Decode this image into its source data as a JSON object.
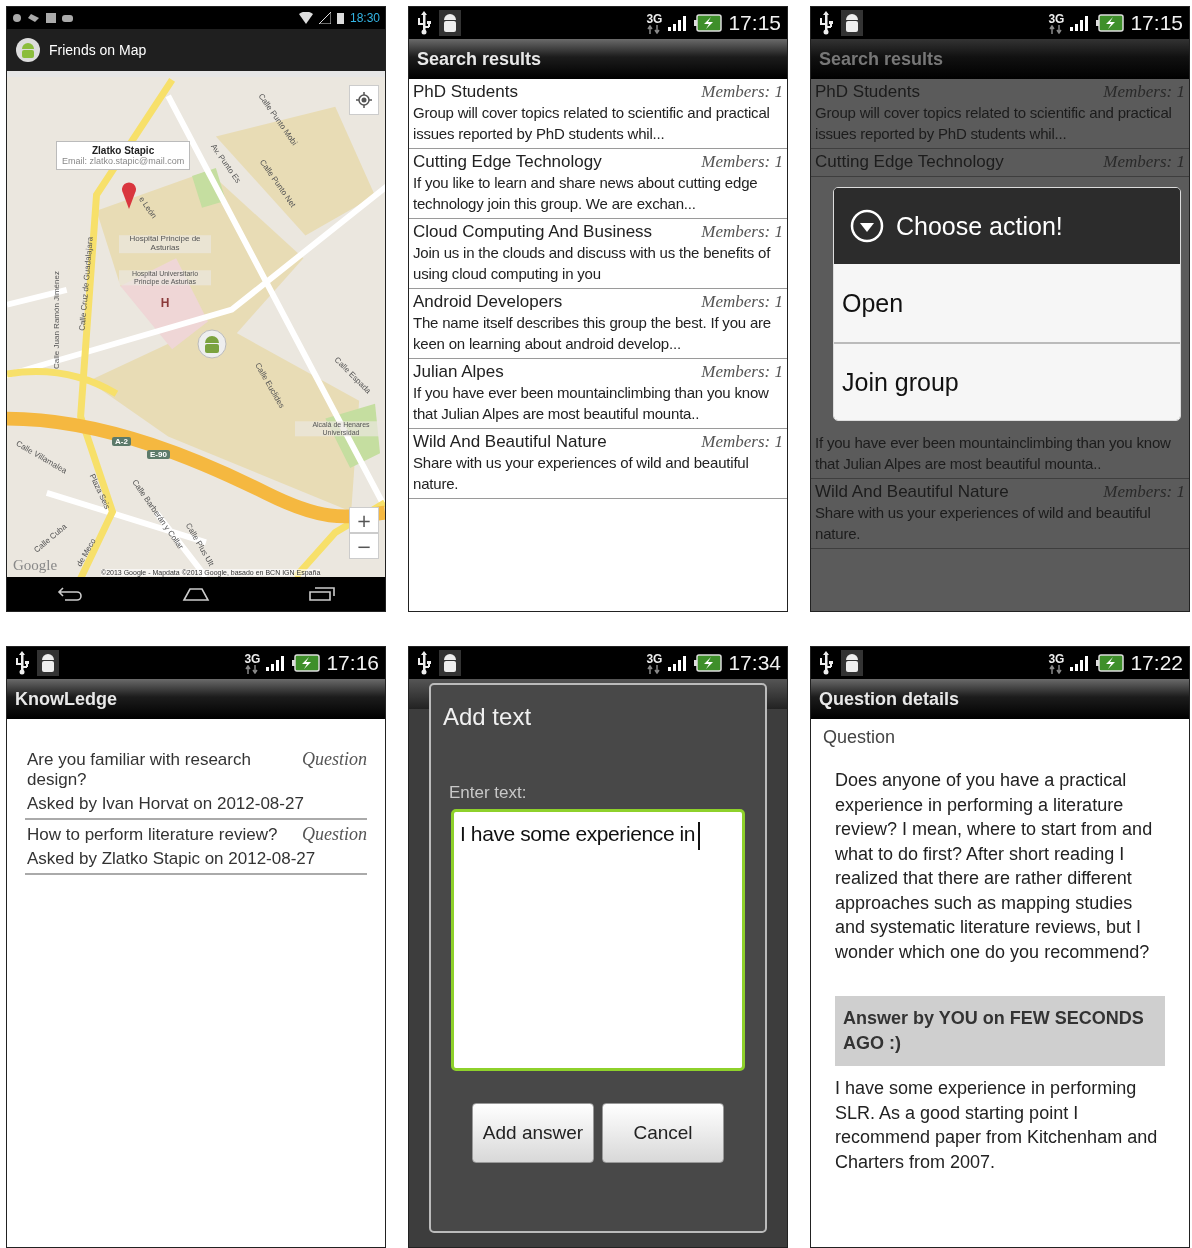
{
  "screens": [
    {
      "kind": "map",
      "status_bar": {
        "time": "18:30"
      },
      "title": "Friends on Map",
      "info_window": {
        "name": "Zlatko Stapic",
        "email": "Email: zlatko.stapic@mail.com"
      },
      "map_labels": [
        "Calle Punto Mobi",
        "Av. Punto Es",
        "Calle Punto Net",
        "e León",
        "Hospital Principe de Asturias",
        "Hospital Universitario Principe de Asturias",
        "H",
        "Calle Juan Ramón Jiménez",
        "Calle Cruz de Guadalajara",
        "Calle Espada",
        "Calle Euclides",
        "Alcalá de Henares Universidad",
        "Calle Villamalea",
        "Plaza Seis",
        "Calle Barberán y Collar",
        "Calle Plus Ult",
        "Calle Cuba",
        "de Meco"
      ],
      "road_badges": [
        "A-2",
        "E-90"
      ],
      "logo": "Google",
      "attribution": "©2013 Google - Mapdata ©2013 Google, basado en BCN IGN España",
      "zoom_buttons": [
        "+",
        "−"
      ]
    },
    {
      "kind": "list",
      "status_bar": {
        "network": "3G",
        "time": "17:15"
      },
      "title": "Search results",
      "groups_above": [
        {
          "name": "PhD Students",
          "members": "Members: 1",
          "description": "Group will cover topics related to scientific and practical issues reported by PhD students whil..."
        },
        {
          "name": "Cutting Edge Technology",
          "members": "Members: 1",
          "description": "If you like to learn and share news about cutting edge technology join this group. We are exchan..."
        },
        {
          "name": "Cloud Computing And Business",
          "members": "Members: 1",
          "description": "Join us in the clouds and discuss with us the benefits of using cloud computing in you"
        },
        {
          "name": "Android Developers",
          "members": "Members: 1",
          "description": "The name itself describes this group the best. If you are keen on learning about android develop..."
        },
        {
          "name": "Julian Alpes",
          "members": "Members: 1",
          "description": "If you have ever been mountainclimbing than you know that Julian Alpes are most beautiful mounta.."
        },
        {
          "name": "Wild And Beautiful Nature",
          "members": "Members: 1",
          "description": "Share with us your experiences of wild and beautiful nature."
        }
      ]
    },
    {
      "kind": "list_dialog",
      "status_bar": {
        "network": "3G",
        "time": "17:15"
      },
      "title": "Search results",
      "groups_above": [
        {
          "name": "PhD Students",
          "members": "Members: 1",
          "description": "Group will cover topics related to scientific and practical issues reported by PhD students whil..."
        },
        {
          "name": "Cutting Edge Technology",
          "members": "Members: 1"
        }
      ],
      "dialog": {
        "title": "Choose action!",
        "options": [
          "Open",
          "Join group"
        ]
      },
      "groups_below": [
        {
          "description": "If you have ever been mountainclimbing than you know that Julian Alpes are most beautiful mounta.."
        },
        {
          "name": "Wild And Beautiful Nature",
          "members": "Members: 1",
          "description": "Share with us your experiences of wild and beautiful nature."
        }
      ]
    },
    {
      "kind": "questions",
      "status_bar": {
        "network": "3G",
        "time": "17:16"
      },
      "title": "KnowLedge",
      "questions": [
        {
          "title": "Are you familiar with research design?",
          "type": "Question",
          "asked": "Asked by Ivan Horvat on 2012-08-27"
        },
        {
          "title": "How to perform literature review?",
          "type": "Question",
          "asked": "Asked by Zlatko Stapic on 2012-08-27"
        }
      ]
    },
    {
      "kind": "text_dialog",
      "status_bar": {
        "network": "3G",
        "time": "17:34"
      },
      "dialog": {
        "title": "Add text",
        "label": "Enter text:",
        "value": "I have some experience in",
        "buttons": [
          "Add answer",
          "Cancel"
        ]
      }
    },
    {
      "kind": "details",
      "status_bar": {
        "network": "3G",
        "time": "17:22"
      },
      "title": "Question details",
      "section": "Question",
      "question": "Does anyone of you have a practical experience in performing a literature review? I mean, where to start from and what to do first? After short reading I realized that there are rather different approaches such as mapping studies and systematic literature reviews, but I wonder which one do you recommend?",
      "answer_header": "Answer by YOU on FEW SECONDS AGO :)",
      "answer": "I have some experience in performing SLR. As a good starting point I recommend paper from Kitchenham and Charters from 2007."
    }
  ]
}
